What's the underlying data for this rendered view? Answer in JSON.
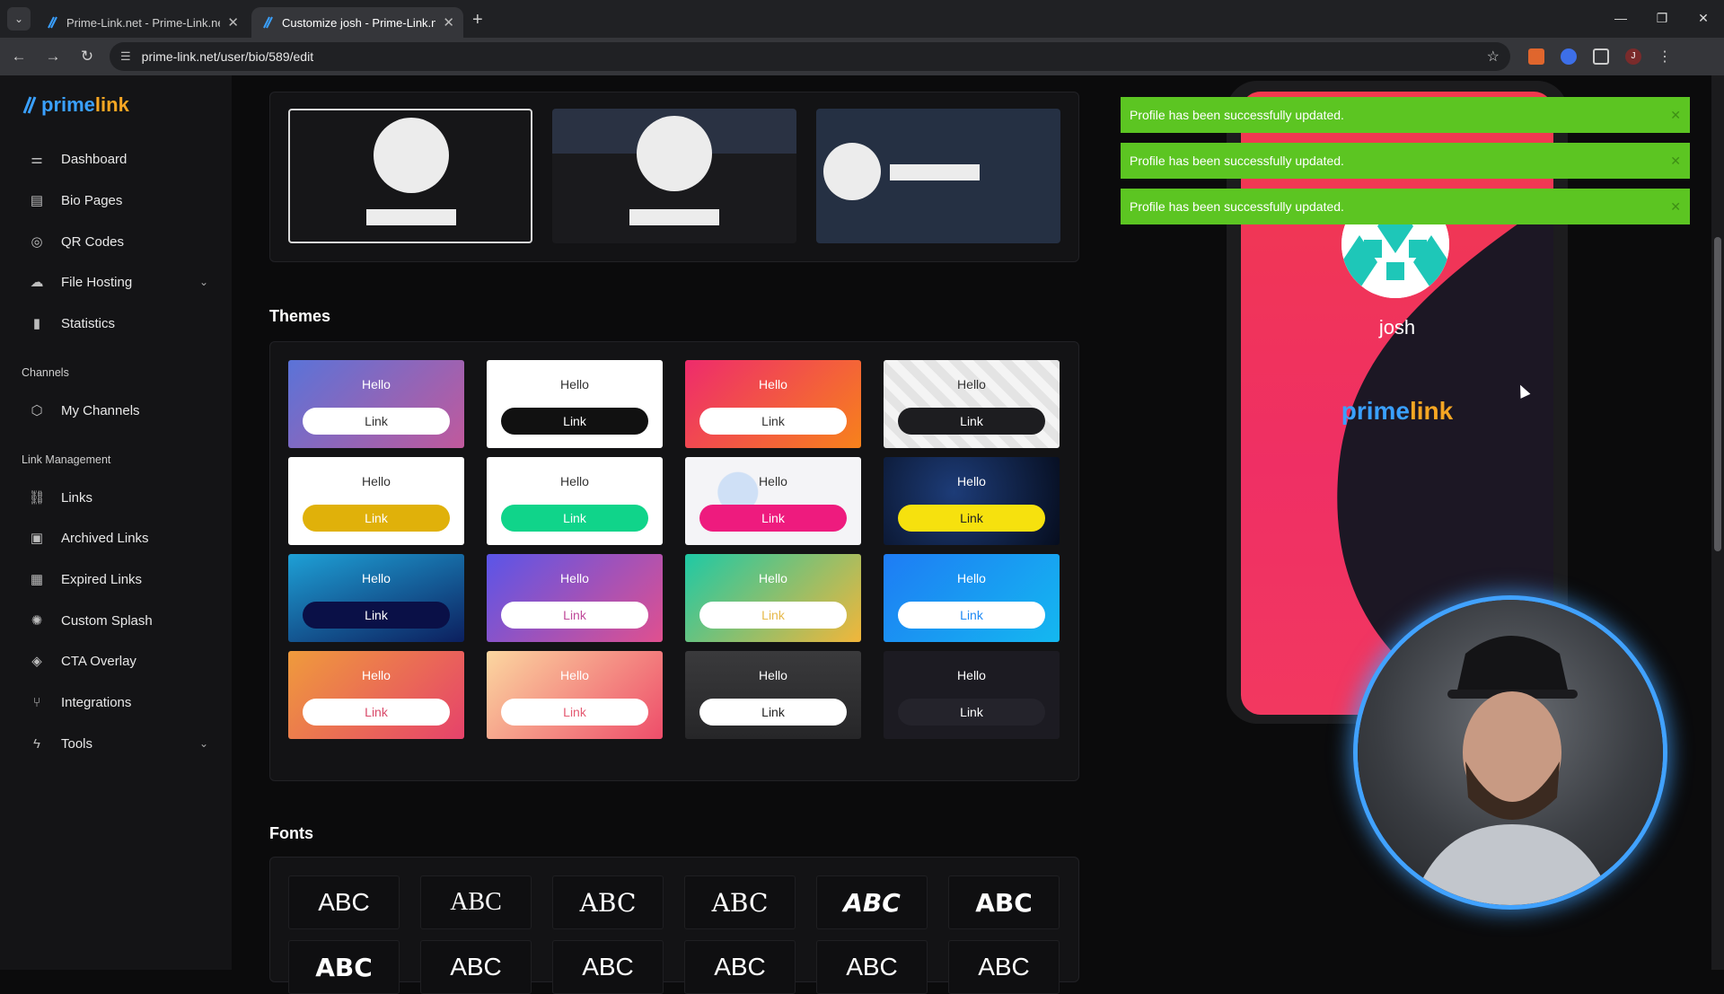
{
  "browser": {
    "tabs": [
      {
        "title": "Prime-Link.net - Prime-Link.net",
        "active": false
      },
      {
        "title": "Customize josh - Prime-Link.ne",
        "active": true
      }
    ],
    "url": "prime-link.net/user/bio/589/edit",
    "profile_initial": "J"
  },
  "sidebar": {
    "logo_part1": "prime",
    "logo_part2": "link",
    "items": [
      {
        "label": "Dashboard",
        "icon": "sliders-icon"
      },
      {
        "label": "Bio Pages",
        "icon": "layout-icon"
      },
      {
        "label": "QR Codes",
        "icon": "qr-icon"
      },
      {
        "label": "File Hosting",
        "icon": "cloud-upload-icon"
      },
      {
        "label": "Statistics",
        "icon": "bar-chart-icon"
      }
    ],
    "channels_heading": "Channels",
    "channel_items": [
      {
        "label": "My Channels",
        "icon": "cube-icon"
      }
    ],
    "link_mgmt_heading": "Link Management",
    "link_items": [
      {
        "label": "Links",
        "icon": "link-icon"
      },
      {
        "label": "Archived Links",
        "icon": "archive-icon"
      },
      {
        "label": "Expired Links",
        "icon": "calendar-icon"
      },
      {
        "label": "Custom Splash",
        "icon": "loader-icon"
      },
      {
        "label": "CTA Overlay",
        "icon": "layers-icon"
      },
      {
        "label": "Integrations",
        "icon": "branch-icon"
      },
      {
        "label": "Tools",
        "icon": "bolt-icon"
      }
    ]
  },
  "main": {
    "themes_heading": "Themes",
    "fonts_heading": "Fonts",
    "theme_hello": "Hello",
    "theme_link": "Link",
    "font_sample": "ABC"
  },
  "preview": {
    "name": "josh",
    "logo_part1": "prime",
    "logo_part2": "link"
  },
  "toasts": [
    "Profile has been successfully updated.",
    "Profile has been successfully updated.",
    "Profile has been successfully updated."
  ],
  "colors": {
    "toast_bg": "#5cc522",
    "accent_blue": "#3aa0ff",
    "accent_orange": "#f6a623"
  }
}
